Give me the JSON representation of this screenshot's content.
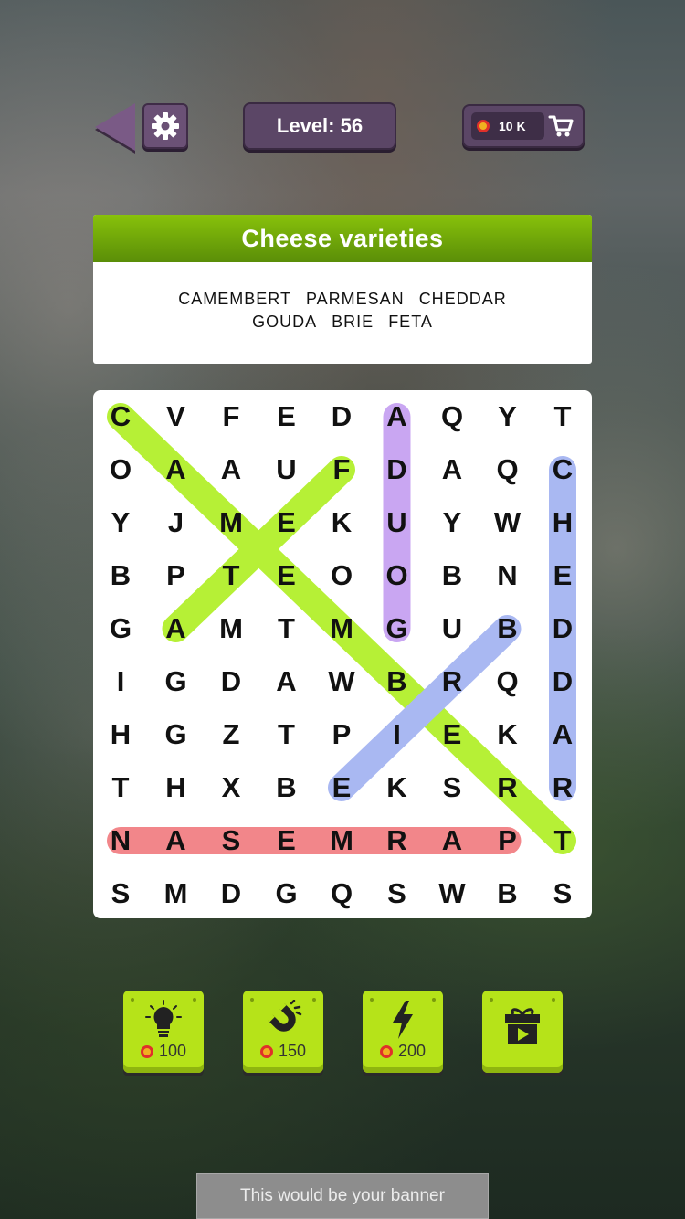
{
  "header": {
    "level_label": "Level: 56",
    "coins": "10 K"
  },
  "category": {
    "title": "Cheese varieties",
    "words": [
      "CAMEMBERT",
      "PARMESAN",
      "CHEDDAR",
      "GOUDA",
      "BRIE",
      "FETA"
    ]
  },
  "grid": {
    "rows": [
      [
        "C",
        "V",
        "F",
        "E",
        "D",
        "A",
        "Q",
        "Y",
        "T"
      ],
      [
        "O",
        "A",
        "A",
        "U",
        "F",
        "D",
        "A",
        "Q",
        "C"
      ],
      [
        "Y",
        "J",
        "M",
        "E",
        "K",
        "U",
        "Y",
        "W",
        "H"
      ],
      [
        "B",
        "P",
        "T",
        "E",
        "O",
        "O",
        "B",
        "N",
        "E"
      ],
      [
        "G",
        "A",
        "M",
        "T",
        "M",
        "G",
        "U",
        "B",
        "D"
      ],
      [
        "I",
        "G",
        "D",
        "A",
        "W",
        "B",
        "R",
        "Q",
        "D"
      ],
      [
        "H",
        "G",
        "Z",
        "T",
        "P",
        "I",
        "E",
        "K",
        "A"
      ],
      [
        "T",
        "H",
        "X",
        "B",
        "E",
        "K",
        "S",
        "R",
        "R"
      ],
      [
        "N",
        "A",
        "S",
        "E",
        "M",
        "R",
        "A",
        "P",
        "T"
      ],
      [
        "S",
        "M",
        "D",
        "G",
        "Q",
        "S",
        "W",
        "B",
        "S"
      ]
    ],
    "highlights": [
      {
        "word": "CAMEMBERT",
        "from": [
          0,
          0
        ],
        "to": [
          8,
          8
        ],
        "color": "#b6f036"
      },
      {
        "word": "FETA",
        "from": [
          1,
          4
        ],
        "to": [
          4,
          1
        ],
        "color": "#b6f036"
      },
      {
        "word": "GOUDA",
        "from": [
          0,
          5
        ],
        "to": [
          4,
          5
        ],
        "color": "#c9a6f2"
      },
      {
        "word": "CHEDDAR",
        "from": [
          1,
          8
        ],
        "to": [
          7,
          8
        ],
        "color": "#a9b8f2"
      },
      {
        "word": "BRIE",
        "from": [
          4,
          7
        ],
        "to": [
          7,
          4
        ],
        "color": "#a9b8f2"
      },
      {
        "word": "PARMESAN",
        "from": [
          8,
          7
        ],
        "to": [
          8,
          0
        ],
        "color": "#f2868a"
      }
    ]
  },
  "boosters": [
    {
      "icon": "lightbulb-icon",
      "price": "100"
    },
    {
      "icon": "magnet-icon",
      "price": "150"
    },
    {
      "icon": "lightning-icon",
      "price": "200"
    },
    {
      "icon": "gift-video-icon",
      "price": ""
    }
  ],
  "banner": {
    "text": "This would be your banner"
  },
  "colors": {
    "accent_green": "#88c20a",
    "panel_purple": "#5b4666",
    "booster_green": "#b6e319"
  }
}
